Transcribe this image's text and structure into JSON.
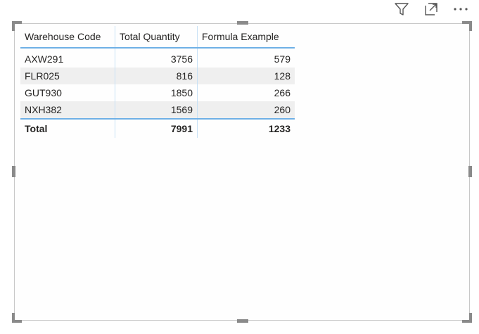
{
  "header_icons": [
    "filter-icon",
    "focus-mode-icon",
    "more-options-icon"
  ],
  "table": {
    "columns": [
      "Warehouse Code",
      "Total Quantity",
      "Formula Example"
    ],
    "rows": [
      {
        "code": "AXW291",
        "quantity": "3756",
        "formula": "579"
      },
      {
        "code": "FLR025",
        "quantity": "816",
        "formula": "128"
      },
      {
        "code": "GUT930",
        "quantity": "1850",
        "formula": "266"
      },
      {
        "code": "NXH382",
        "quantity": "1569",
        "formula": "260"
      }
    ],
    "total": {
      "label": "Total",
      "quantity": "7991",
      "formula": "1233"
    }
  },
  "colors": {
    "header_border": "#6fb0e6",
    "row_shade": "#efefef",
    "handle": "#8a8a8a"
  }
}
